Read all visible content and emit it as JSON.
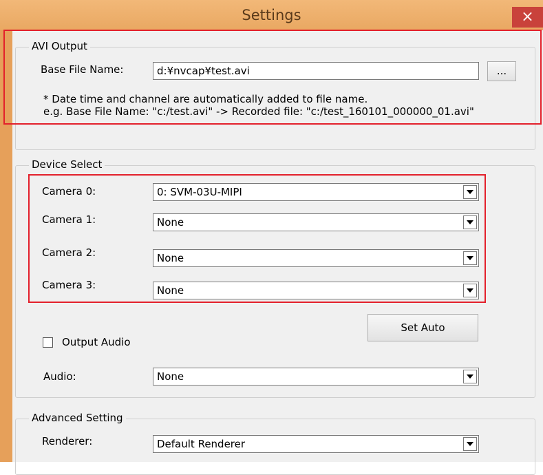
{
  "window": {
    "title": "Settings",
    "close_glyph": "×"
  },
  "avi_output": {
    "legend": "AVI Output",
    "base_file_name_label": "Base File Name:",
    "base_file_name_value": "d:¥nvcap¥test.avi",
    "browse_button": "...",
    "note_line1": "* Date time and channel are automatically added to file name.",
    "note_line2": "e.g. Base File Name: \"c:/test.avi\" -> Recorded file: \"c:/test_160101_000000_01.avi\""
  },
  "device_select": {
    "legend": "Device Select",
    "cameras": [
      {
        "label": "Camera 0:",
        "value": "0: SVM-03U-MIPI"
      },
      {
        "label": "Camera 1:",
        "value": "None"
      },
      {
        "label": "Camera 2:",
        "value": "None"
      },
      {
        "label": "Camera 3:",
        "value": "None"
      }
    ],
    "set_auto_button": "Set Auto",
    "output_audio_label": "Output Audio",
    "output_audio_checked": false,
    "audio_label": "Audio:",
    "audio_value": "None"
  },
  "advanced": {
    "legend": "Advanced Setting",
    "renderer_label": "Renderer:",
    "renderer_value": "Default Renderer"
  },
  "colors": {
    "highlight": "#e3202b",
    "close": "#c9423b",
    "titlebar": "#e9a862"
  }
}
